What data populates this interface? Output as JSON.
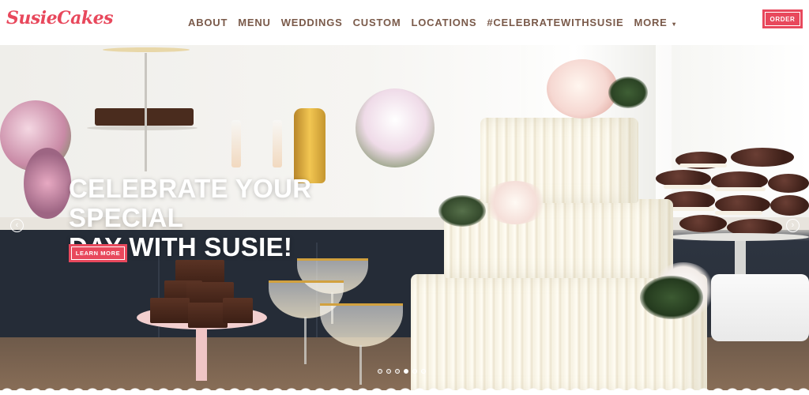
{
  "header": {
    "logo": "SusieCakes",
    "nav": [
      {
        "label": "ABOUT",
        "name": "nav-about"
      },
      {
        "label": "MENU",
        "name": "nav-menu"
      },
      {
        "label": "WEDDINGS",
        "name": "nav-weddings"
      },
      {
        "label": "CUSTOM",
        "name": "nav-custom"
      },
      {
        "label": "LOCATIONS",
        "name": "nav-locations"
      },
      {
        "label": "#CELEBRATEWITHSUSIE",
        "name": "nav-celebratewithsusie"
      },
      {
        "label": "MORE",
        "name": "nav-more",
        "caret": "▾"
      }
    ],
    "order_label": "ORDER"
  },
  "hero": {
    "headline_line1": "CELEBRATE YOUR SPECIAL",
    "headline_line2": "DAY WITH SUSIE!",
    "cta_label": "LEARN MORE",
    "prev_icon": "‹",
    "next_icon": "›",
    "slide_count": 6,
    "active_slide": 4
  },
  "colors": {
    "brand": "#e8485c",
    "nav_text": "#7a5a4a"
  }
}
